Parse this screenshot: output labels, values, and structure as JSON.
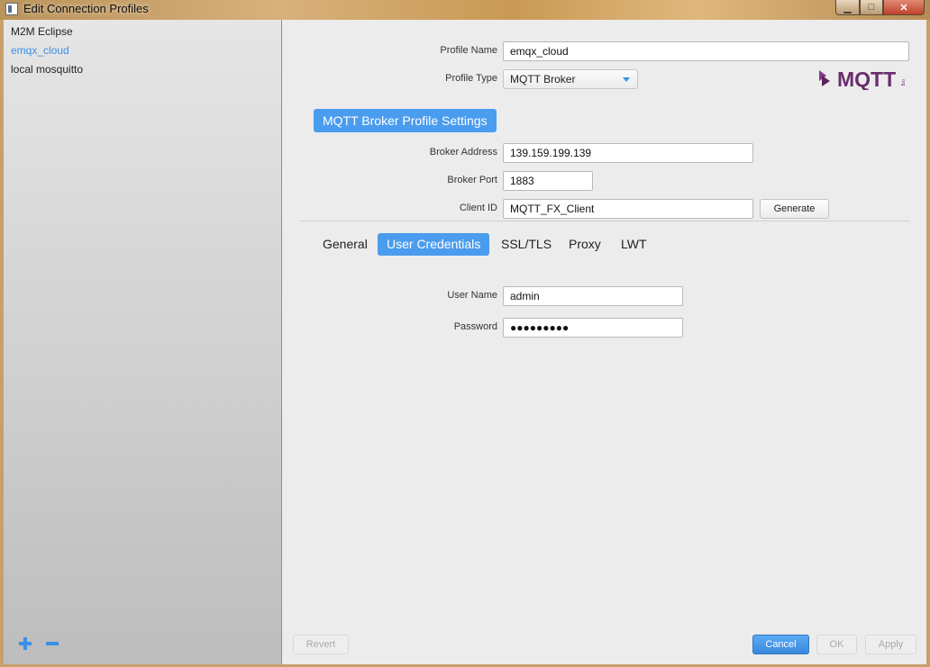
{
  "window": {
    "title": "Edit Connection Profiles",
    "controls": {
      "minimize": "▁",
      "maximize": "□",
      "close": "✕"
    }
  },
  "sidebar": {
    "profiles": [
      {
        "label": "M2M Eclipse",
        "selected": false
      },
      {
        "label": "emqx_cloud",
        "selected": true
      },
      {
        "label": "local mosquitto",
        "selected": false
      }
    ],
    "add_icon": "plus-icon",
    "remove_icon": "minus-icon"
  },
  "form": {
    "profile_name_label": "Profile Name",
    "profile_name_value": "emqx_cloud",
    "profile_type_label": "Profile Type",
    "profile_type_value": "MQTT Broker",
    "logo_text": "MQTT",
    "logo_subtext": "org",
    "section_title": "MQTT Broker Profile Settings",
    "broker_address_label": "Broker Address",
    "broker_address_value": "139.159.199.139",
    "broker_port_label": "Broker Port",
    "broker_port_value": "1883",
    "client_id_label": "Client ID",
    "client_id_value": "MQTT_FX_Client",
    "generate_label": "Generate"
  },
  "tabs": [
    {
      "label": "General",
      "active": false
    },
    {
      "label": "User Credentials",
      "active": true
    },
    {
      "label": "SSL/TLS",
      "active": false
    },
    {
      "label": "Proxy",
      "active": false
    },
    {
      "label": "LWT",
      "active": false
    }
  ],
  "credentials": {
    "user_name_label": "User Name",
    "user_name_value": "admin",
    "password_label": "Password",
    "password_value": "●●●●●●●●●"
  },
  "footer": {
    "revert_label": "Revert",
    "cancel_label": "Cancel",
    "ok_label": "OK",
    "apply_label": "Apply"
  },
  "colors": {
    "accent": "#4a9cee",
    "selected_text": "#3b8fe6",
    "logo_purple": "#6b2c6e"
  }
}
